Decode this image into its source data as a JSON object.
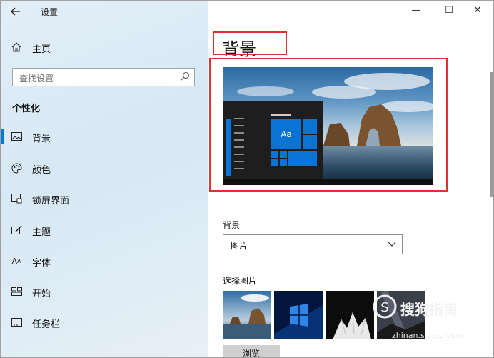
{
  "window": {
    "title": "设置",
    "controls": {
      "minimize": "—",
      "maximize": "☐",
      "close": "✕"
    }
  },
  "sidebar": {
    "back_icon": "arrow-left-icon",
    "home": {
      "label": "主页",
      "icon": "home-icon"
    },
    "search": {
      "placeholder": "查找设置",
      "icon": "search-icon"
    },
    "section": "个性化",
    "items": [
      {
        "label": "背景",
        "icon": "image-icon",
        "active": true
      },
      {
        "label": "颜色",
        "icon": "palette-icon"
      },
      {
        "label": "锁屏界面",
        "icon": "lock-screen-icon"
      },
      {
        "label": "主题",
        "icon": "theme-icon"
      },
      {
        "label": "字体",
        "icon": "font-icon"
      },
      {
        "label": "开始",
        "icon": "start-icon"
      },
      {
        "label": "任务栏",
        "icon": "taskbar-icon"
      }
    ]
  },
  "main": {
    "title": "背景",
    "preview": {
      "tile_text": "Aa"
    },
    "background_field": {
      "label": "背景",
      "value": "图片"
    },
    "choose_picture": {
      "label": "选择图片"
    },
    "browse_button": "浏览"
  },
  "watermark": {
    "text": "搜狗指南",
    "url": "zhinan.sogou.com"
  },
  "colors": {
    "accent": "#0078d7",
    "annotation": "#e0322e"
  }
}
